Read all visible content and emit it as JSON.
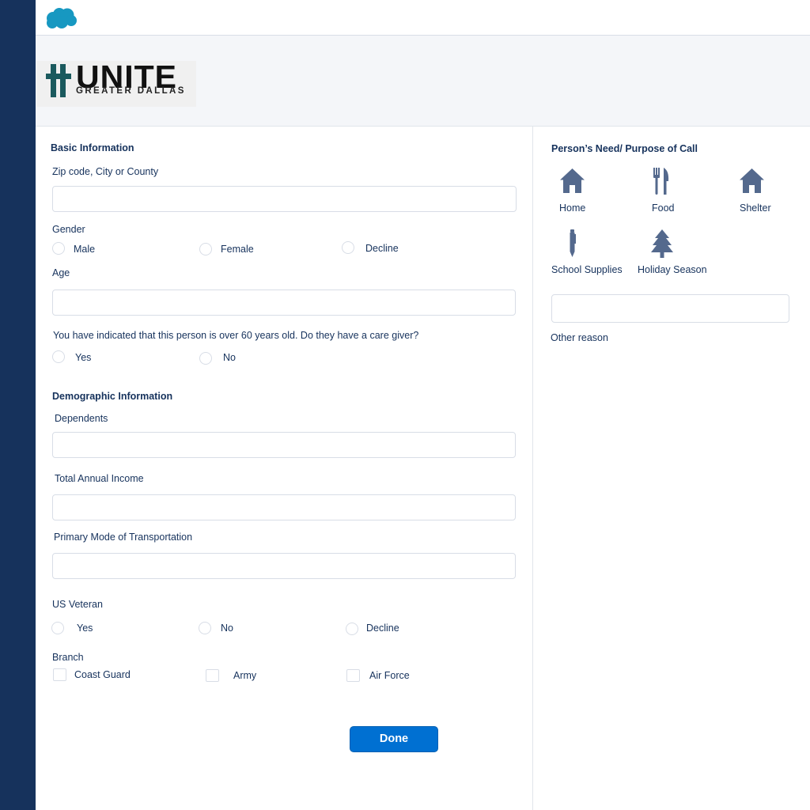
{
  "brand": {
    "word": "UNITE",
    "sub": "GREATER DALLAS"
  },
  "basic": {
    "title": "Basic Information",
    "zip_label": "Zip code, City or County",
    "zip_value": "",
    "gender_label": "Gender",
    "gender_options": [
      "Male",
      "Female",
      "Decline"
    ],
    "age_label": "Age",
    "age_value": "",
    "caregiver_question": "You have indicated that this person is over 60 years old. Do they have a care giver?",
    "caregiver_options": [
      "Yes",
      "No"
    ]
  },
  "demographic": {
    "title": "Demographic Information",
    "dependents_label": "Dependents",
    "income_label": "Total Annual Income",
    "transport_label": "Primary Mode of Transportation",
    "veteran_label": "US Veteran",
    "veteran_options": [
      "Yes",
      "No",
      "Decline"
    ],
    "branch_label": "Branch",
    "branch_options": [
      "Coast Guard",
      "Army",
      "Air Force"
    ]
  },
  "done_label": "Done",
  "needs": {
    "title": "Person’s Need/ Purpose of Call",
    "items": [
      {
        "label": "Home",
        "icon": "home-icon"
      },
      {
        "label": "Food",
        "icon": "fork-knife-icon"
      },
      {
        "label": "Shelter",
        "icon": "home-icon"
      },
      {
        "label": "School Supplies",
        "icon": "pen-icon"
      },
      {
        "label": "Holiday Season",
        "icon": "tree-icon"
      }
    ],
    "other_value": "",
    "other_label": "Other reason"
  },
  "colors": {
    "accent": "#0070d2",
    "rail": "#16325c",
    "text": "#16325c",
    "icon": "#54698d"
  }
}
